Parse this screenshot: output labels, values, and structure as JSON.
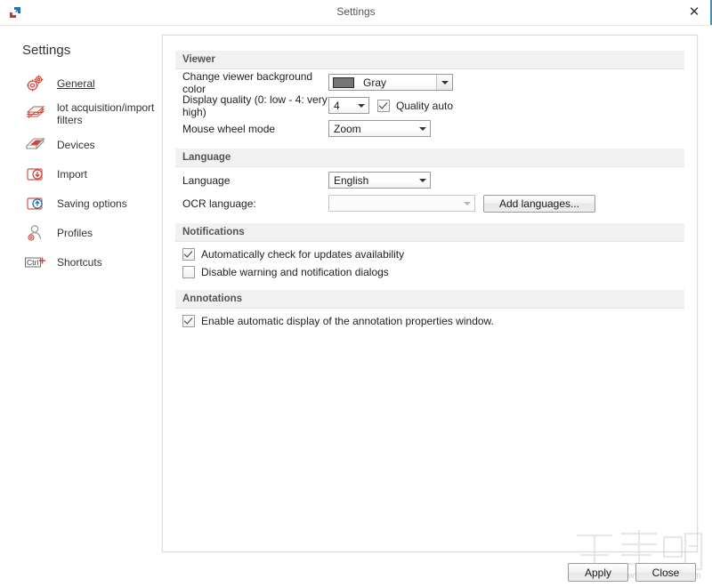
{
  "window": {
    "title": "Settings",
    "app_icon": "overlapping-arrows-icon",
    "close_label": "✕",
    "accent_color": "#4a90ad"
  },
  "sidebar": {
    "heading": "Settings",
    "items": [
      {
        "label": "General",
        "icon": "gears-icon",
        "active": true
      },
      {
        "label": "lot acquisition/import filters",
        "icon": "stacked-pages-icon",
        "active": false
      },
      {
        "label": "Devices",
        "icon": "scanner-icon",
        "active": false
      },
      {
        "label": "Import",
        "icon": "import-down-arrow-icon",
        "active": false
      },
      {
        "label": "Saving options",
        "icon": "save-up-arrow-icon",
        "active": false
      },
      {
        "label": "Profiles",
        "icon": "user-profile-icon",
        "active": false
      },
      {
        "label": "Shortcuts",
        "icon": "ctrl-key-icon",
        "active": false
      }
    ]
  },
  "sections": {
    "viewer": {
      "title": "Viewer",
      "background_color": {
        "label": "Change viewer background color",
        "value": "Gray",
        "swatch_color": "#767676"
      },
      "display_quality": {
        "label": "Display quality (0: low - 4: very high)",
        "value": "4",
        "quality_auto_label": "Quality auto",
        "quality_auto_checked": true
      },
      "mouse_wheel": {
        "label": "Mouse wheel mode",
        "value": "Zoom"
      }
    },
    "language": {
      "title": "Language",
      "language": {
        "label": "Language",
        "value": "English"
      },
      "ocr_language": {
        "label": "OCR language:",
        "value": "",
        "disabled": true
      },
      "add_languages_label": "Add languages..."
    },
    "notifications": {
      "title": "Notifications",
      "items": [
        {
          "label": "Automatically check for updates availability",
          "checked": true
        },
        {
          "label": "Disable warning and notification dialogs",
          "checked": false
        }
      ]
    },
    "annotations": {
      "title": "Annotations",
      "items": [
        {
          "label": "Enable automatic display of the annotation properties window.",
          "checked": true
        }
      ]
    }
  },
  "footer": {
    "apply_label": "Apply",
    "close_label": "Close"
  },
  "watermark": {
    "text": "下载吧",
    "url": "www.xiazaiba.com"
  }
}
